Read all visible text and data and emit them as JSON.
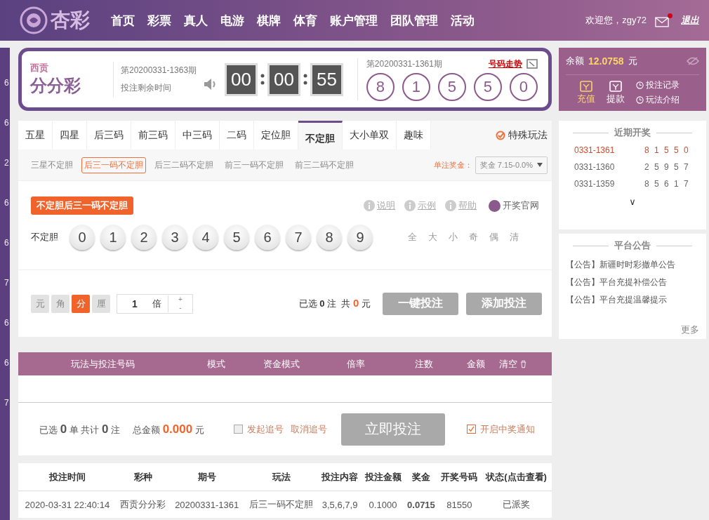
{
  "header": {
    "logo_text": "杏彩",
    "nav": [
      "首页",
      "彩票",
      "真人",
      "电游",
      "棋牌",
      "体育",
      "账户管理",
      "团队管理",
      "活动"
    ],
    "welcome": "欢迎您，zgy72",
    "mail_unread": true,
    "logout": "退出"
  },
  "side_strip": [
    "6",
    "6",
    "2",
    "6",
    "6",
    "7",
    "6",
    "6",
    "7"
  ],
  "game": {
    "brand_top": "西贡",
    "brand": "分分彩",
    "period": "第20200331-1363期",
    "countdown_label": "投注剩余时间",
    "timer": [
      "00",
      "00",
      "55"
    ],
    "last_period": "第20200331-1361期",
    "trend_link": "号码走势",
    "last_numbers": [
      "8",
      "1",
      "5",
      "5",
      "0"
    ]
  },
  "account": {
    "balance_label": "余额",
    "balance": "12.0758",
    "unit": "元",
    "actions": [
      {
        "label": "充值",
        "selected": true
      },
      {
        "label": "提款",
        "selected": false
      }
    ],
    "links": [
      "投注记录",
      "玩法介绍"
    ]
  },
  "tabs": [
    {
      "label": "五星",
      "selected": false
    },
    {
      "label": "四星",
      "selected": false
    },
    {
      "label": "后三码",
      "selected": false
    },
    {
      "label": "前三码",
      "selected": false
    },
    {
      "label": "中三码",
      "selected": false
    },
    {
      "label": "二码",
      "selected": false
    },
    {
      "label": "定位胆",
      "selected": false
    },
    {
      "label": "不定胆",
      "selected": true
    },
    {
      "label": "大小单双",
      "selected": false
    },
    {
      "label": "趣味",
      "selected": false
    }
  ],
  "special": "特殊玩法",
  "subtabs": [
    {
      "label": "三星不定胆",
      "selected": false
    },
    {
      "label": "后三一码不定胆",
      "selected": true
    },
    {
      "label": "后三二码不定胆",
      "selected": false
    },
    {
      "label": "前三一码不定胆",
      "selected": false
    },
    {
      "label": "前三二码不定胆",
      "selected": false
    }
  ],
  "prize_label": "单注奖金：",
  "prize_select": "奖金 7.15-0.0%",
  "tooltip": "不定胆后三一码不定胆",
  "help_links": [
    "说明",
    "示例",
    "帮助"
  ],
  "official": "开奖官网",
  "row_label": "不定胆",
  "balls": [
    {
      "label": "0",
      "selected": false
    },
    {
      "label": "1",
      "selected": false
    },
    {
      "label": "2",
      "selected": false
    },
    {
      "label": "3",
      "selected": false
    },
    {
      "label": "4",
      "selected": false
    },
    {
      "label": "5",
      "selected": false
    },
    {
      "label": "6",
      "selected": false
    },
    {
      "label": "7",
      "selected": false
    },
    {
      "label": "8",
      "selected": false
    },
    {
      "label": "9",
      "selected": false
    }
  ],
  "quick": [
    "全",
    "大",
    "小",
    "奇",
    "偶",
    "清"
  ],
  "units": [
    {
      "label": "元",
      "selected": false
    },
    {
      "label": "角",
      "selected": false
    },
    {
      "label": "分",
      "selected": true
    },
    {
      "label": "厘",
      "selected": false
    }
  ],
  "multiplier": "1",
  "multiplier_unit": "倍",
  "plus": "+",
  "minus": "-",
  "picked": {
    "label": "已选",
    "count": "0",
    "count_unit": "注",
    "total_label": "共",
    "total": "0",
    "total_unit": "元"
  },
  "buttons": [
    "一键投注",
    "添加投注"
  ],
  "recent": {
    "title": "近期开奖",
    "rows": [
      {
        "period": "0331-1361",
        "numbers": "8 1 5 5 0",
        "selected": true
      },
      {
        "period": "0331-1360",
        "numbers": "2 5 9 5 7",
        "selected": false
      },
      {
        "period": "0331-1359",
        "numbers": "8 5 6 1 7",
        "selected": false
      }
    ],
    "more": "∨"
  },
  "notices": {
    "title": "平台公告",
    "items": [
      "【公告】新疆时时彩撤单公告",
      "【公告】平台充提补偿公告",
      "【公告】平台充提温馨提示"
    ],
    "more": "更多"
  },
  "bet_list": {
    "columns": [
      "玩法与投注号码",
      "模式",
      "资金模式",
      "倍率",
      "注数",
      "金额"
    ],
    "clear": "清空"
  },
  "summary": {
    "picked_label": "已选",
    "orders": "0",
    "orders_unit": "单",
    "total_label": "共计",
    "bets": "0",
    "bets_unit": "注",
    "amount_label": "总金额",
    "amount": "0.000",
    "amount_unit": "元",
    "chase": {
      "label": "发起追号",
      "checked": false
    },
    "cancel_chase": "取消追号",
    "submit": "立即投注",
    "notify": {
      "label": "开启中奖通知",
      "checked": true
    }
  },
  "history": {
    "columns": [
      "投注时间",
      "彩种",
      "期号",
      "玩法",
      "投注内容",
      "投注金额",
      "奖金",
      "开奖号码",
      "状态(点击查看)"
    ],
    "rows": [
      [
        "2020-03-31 22:40:14",
        "西贡分分彩",
        "20200331-1361",
        "后三一码不定胆",
        "3,5,6,7,9",
        "0.1000",
        "0.0715",
        "81550",
        "已派奖"
      ]
    ]
  }
}
